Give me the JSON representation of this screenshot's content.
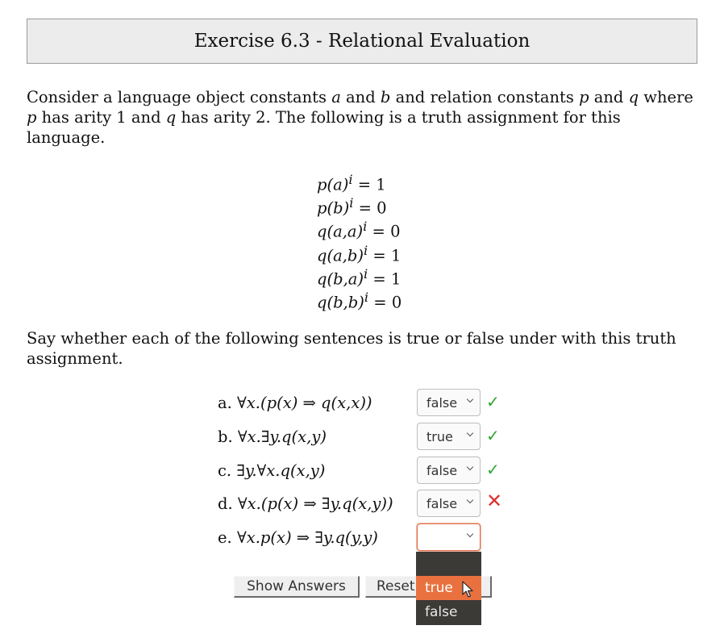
{
  "title": "Exercise 6.3 - Relational Evaluation",
  "intro": {
    "t1": "Consider a language object constants ",
    "a": "a",
    "t2": " and ",
    "b": "b",
    "t3": " and relation constants ",
    "p": "p",
    "t4": " and ",
    "q": "q",
    "t5": " where ",
    "p2": "p",
    "t6": " has arity 1 and ",
    "q2": "q",
    "t7": " has arity 2. The following is a truth assignment for this language."
  },
  "assignments": [
    {
      "lhs": "p(a)",
      "sup": "i",
      "rhs": " = 1"
    },
    {
      "lhs": "p(b)",
      "sup": "i",
      "rhs": " = 0"
    },
    {
      "lhs": "q(a,a)",
      "sup": "i",
      "rhs": " = 0"
    },
    {
      "lhs": "q(a,b)",
      "sup": "i",
      "rhs": " = 1"
    },
    {
      "lhs": "q(b,a)",
      "sup": "i",
      "rhs": " = 1"
    },
    {
      "lhs": "q(b,b)",
      "sup": "i",
      "rhs": " = 0"
    }
  ],
  "instruction": "Say whether each of the following sentences is true or false under with this truth assignment.",
  "questions": [
    {
      "label": "a.",
      "formula": "∀x.(p(x) ⇒ q(x,x))",
      "answer": "false",
      "mark": "✓"
    },
    {
      "label": "b.",
      "formula": "∀x.∃y.q(x,y)",
      "answer": "true",
      "mark": "✓"
    },
    {
      "label": "c.",
      "formula": "∃y.∀x.q(x,y)",
      "answer": "false",
      "mark": "✓"
    },
    {
      "label": "d.",
      "formula": "∀x.(p(x) ⇒ ∃y.q(x,y))",
      "answer": "false",
      "mark": "✕"
    },
    {
      "label": "e.",
      "formula": "∀x.p(x) ⇒ ∃y.q(y,y)",
      "answer": "",
      "mark": ""
    }
  ],
  "dropdown_options": [
    "",
    "true",
    "false"
  ],
  "highlighted_option": "true",
  "buttons": {
    "show": "Show Answers",
    "reset": "Reset"
  },
  "colors": {
    "check": "#2ea62e",
    "cross": "#e03030",
    "highlight": "#e9713f",
    "dropdown_bg": "#3b3a37"
  }
}
